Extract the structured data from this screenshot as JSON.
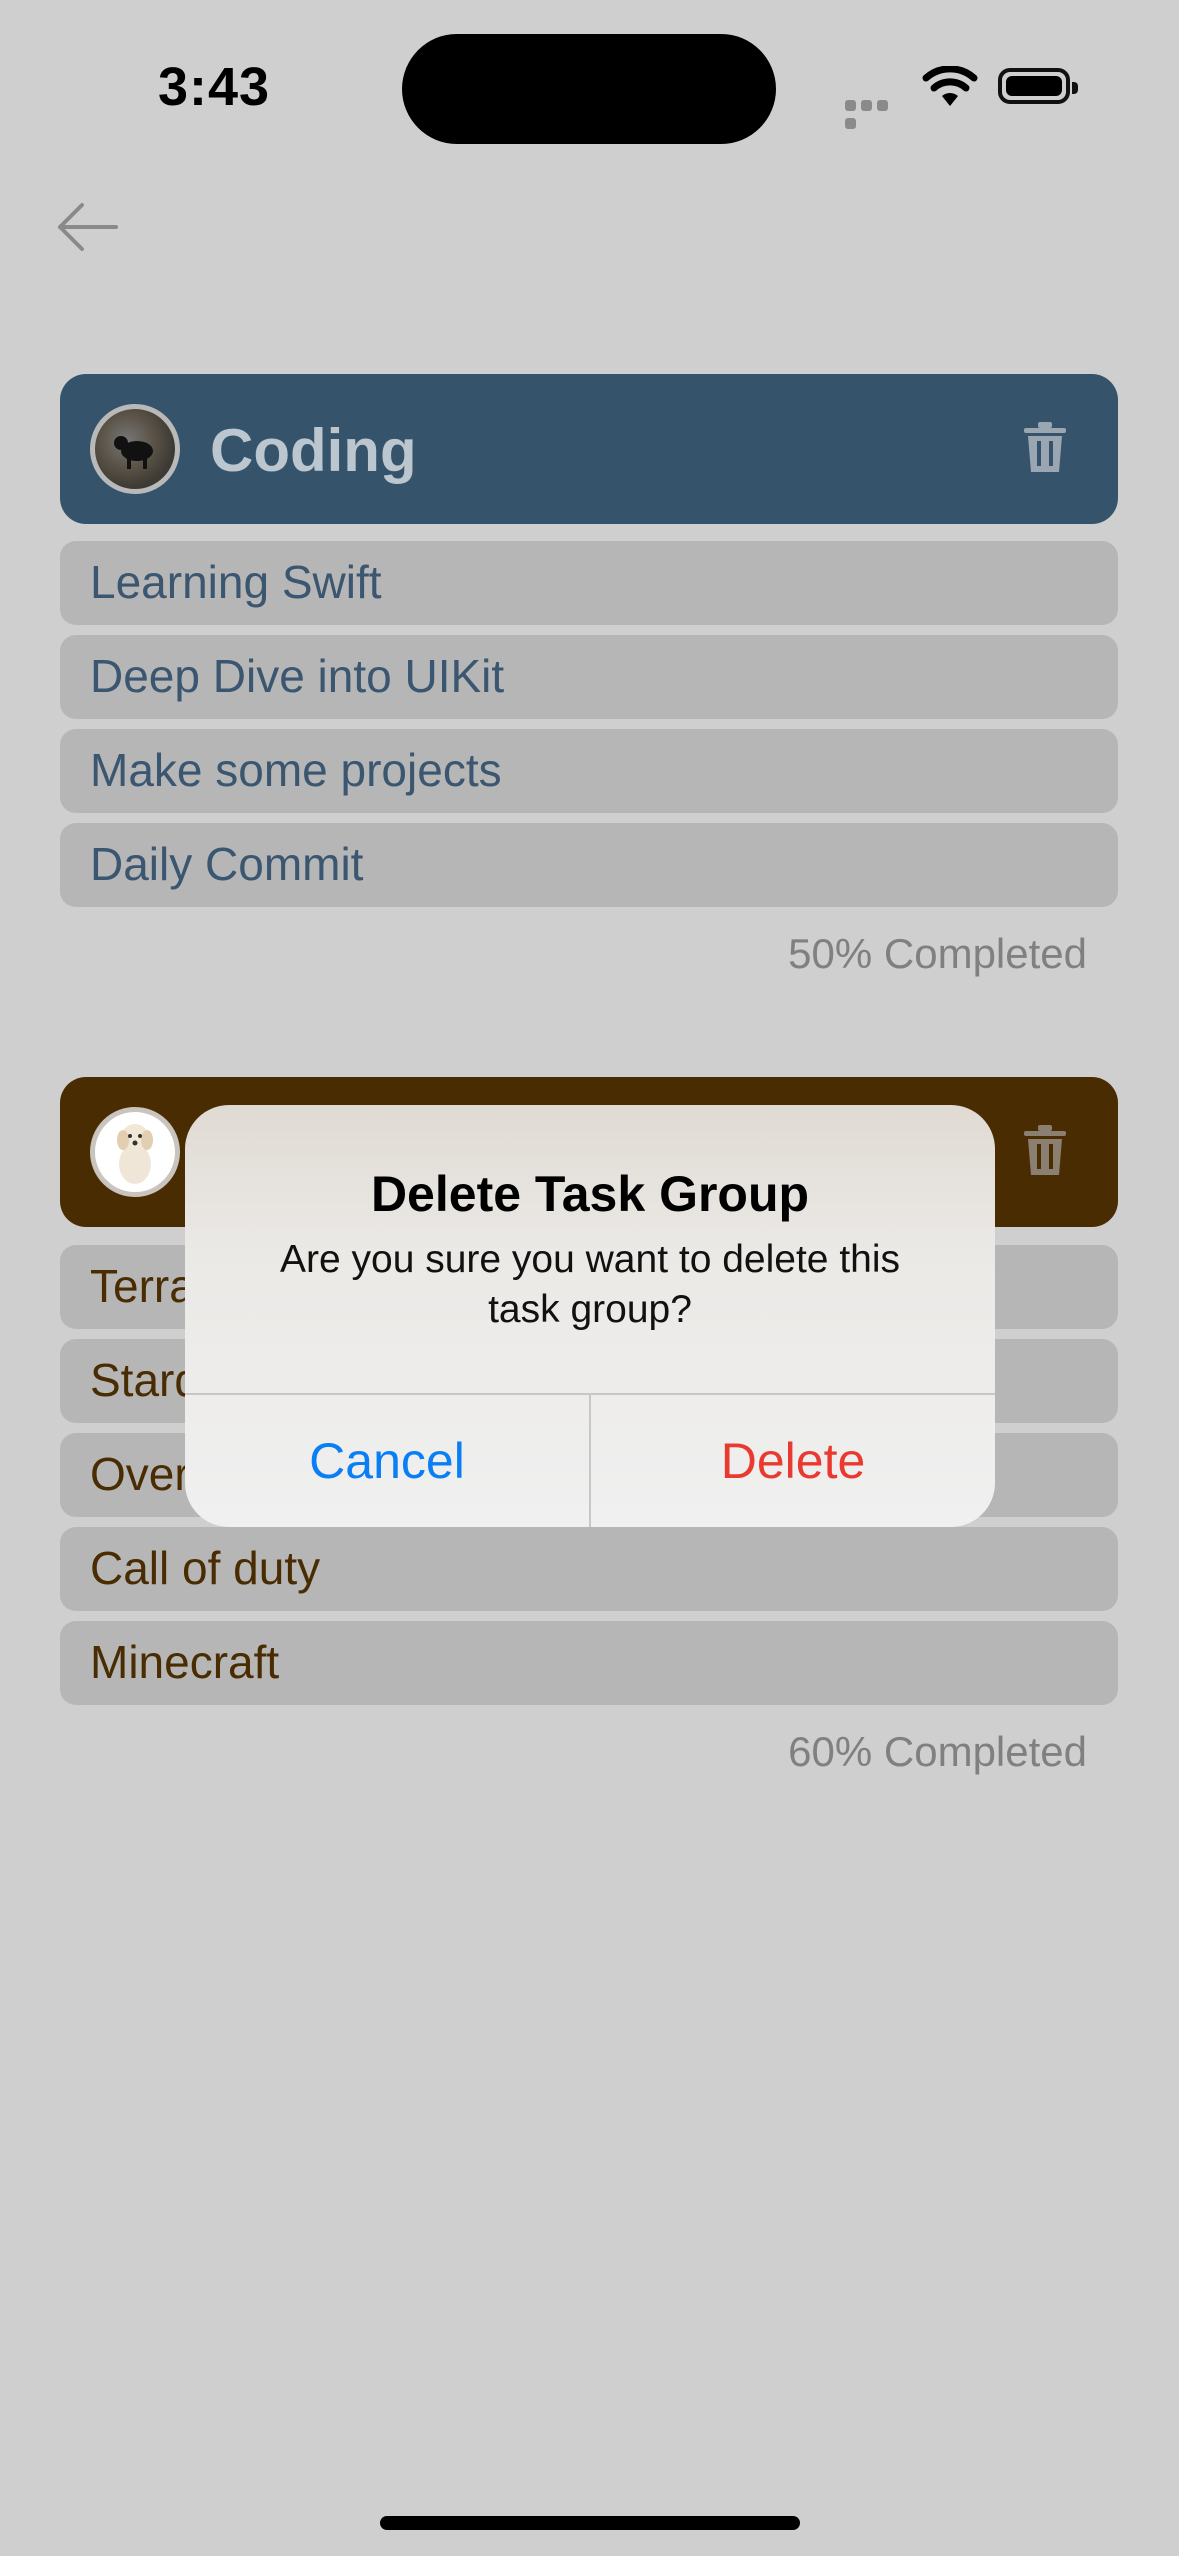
{
  "status_bar": {
    "time": "3:43"
  },
  "groups": [
    {
      "title": "Coding",
      "tasks": [
        "Learning Swift",
        "Deep Dive into UIKit",
        "Make some projects",
        "Daily Commit"
      ],
      "progress": "50% Completed",
      "color": "#35546b"
    },
    {
      "title": "",
      "tasks": [
        "Terra",
        "Stard",
        "Over",
        "Call of duty",
        "Minecraft"
      ],
      "progress": "60% Completed",
      "color": "#4a2c03"
    }
  ],
  "alert": {
    "title": "Delete Task Group",
    "message": "Are you sure you want to delete this task group?",
    "cancel_label": "Cancel",
    "delete_label": "Delete",
    "cancel_color": "#0a7ff5",
    "delete_color": "#ea3a2f"
  },
  "icons": [
    "back-arrow-icon",
    "trash-icon",
    "wifi-icon",
    "battery-icon",
    "signal-icon"
  ]
}
